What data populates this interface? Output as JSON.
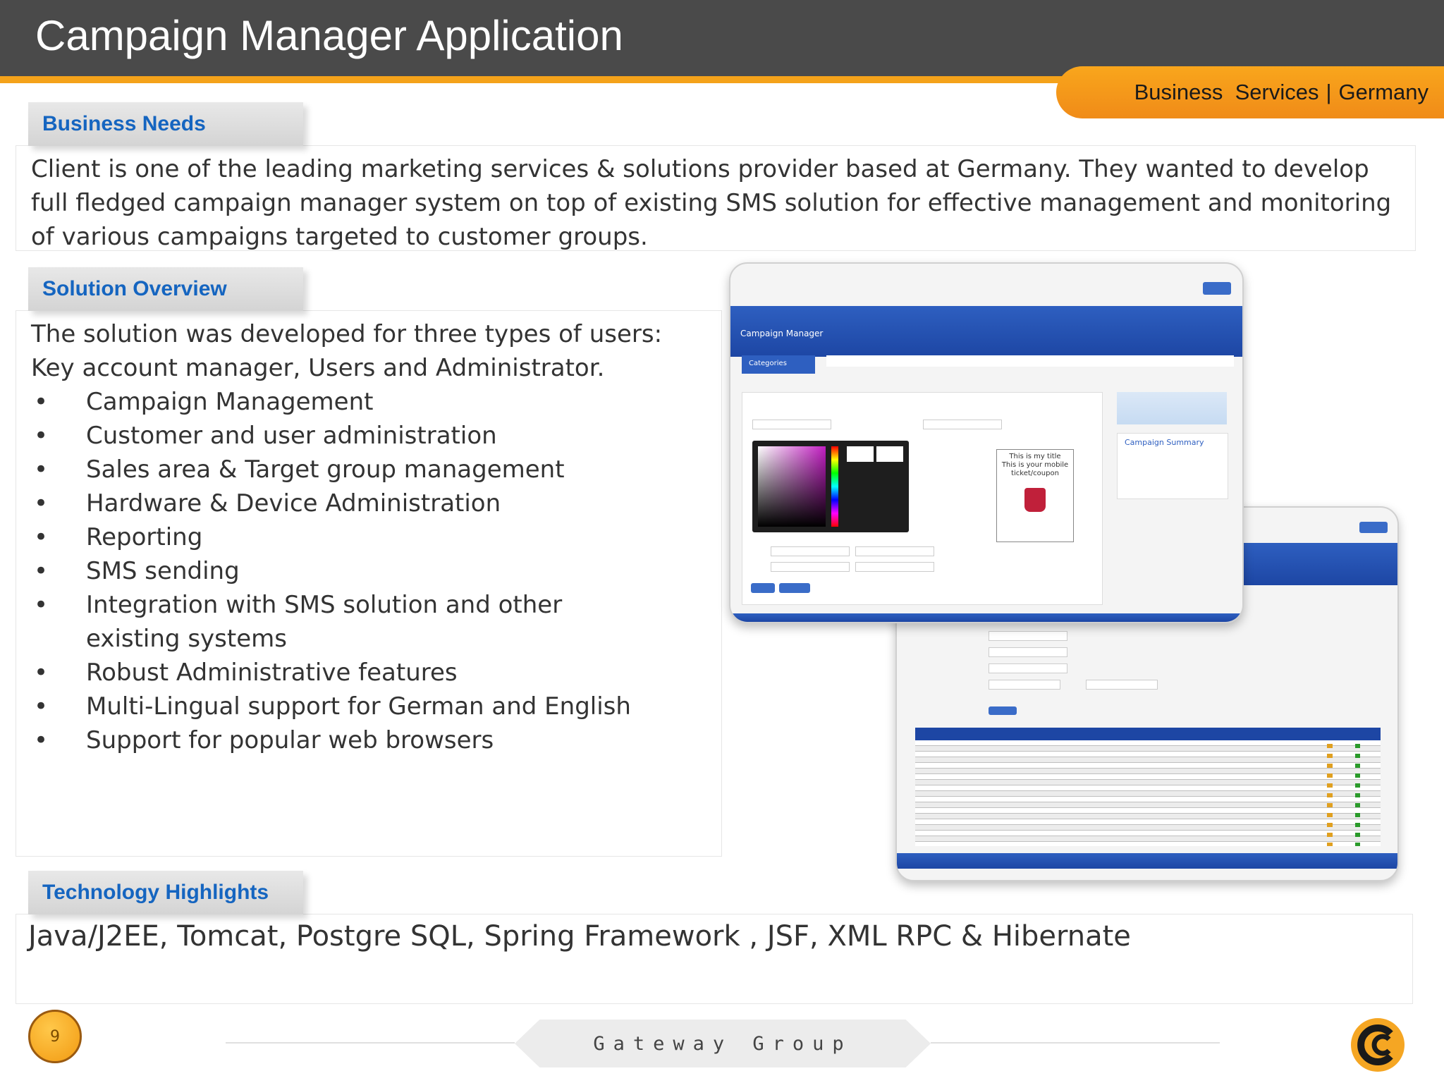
{
  "title": "Campaign Manager Application",
  "region": {
    "left": "Business  Services",
    "sep": "|",
    "right": "Germany"
  },
  "business_needs": {
    "label": "Business Needs",
    "text": "Client is one of the leading marketing services & solutions provider based at Germany. They wanted to develop full fledged campaign manager system on top of existing SMS solution for effective management and monitoring of various campaigns targeted to customer groups."
  },
  "solution": {
    "label": "Solution Overview",
    "intro_1": "The solution was developed for three types of users:",
    "intro_2": "Key account manager, Users and Administrator.",
    "bullet": "•",
    "items": [
      "Campaign Management",
      "Customer and user administration",
      "Sales area & Target group management",
      "Hardware & Device Administration",
      "Reporting",
      "SMS sending",
      "Integration with SMS solution and other existing systems",
      "Robust Administrative features",
      "Multi-Lingual support for German and English",
      "Support for popular web browsers"
    ]
  },
  "tech": {
    "label": "Technology Highlights",
    "text": "Java/J2EE, Tomcat, Postgre SQL, Spring Framework , JSF, XML RPC & Hibernate"
  },
  "mockup": {
    "app_name": "Campaign Manager",
    "categories": "Categories",
    "summary_title": "Campaign Summary",
    "coupon_lines": [
      "This is my title",
      "This is your mobile",
      "ticket/coupon"
    ]
  },
  "footer": {
    "brand": "Gateway Group",
    "page": "9"
  },
  "colors": {
    "accent": "#f4a21a",
    "title_bg": "#4a4a4a",
    "heading_blue": "#1565c0",
    "app_blue": "#2e5fc0"
  }
}
